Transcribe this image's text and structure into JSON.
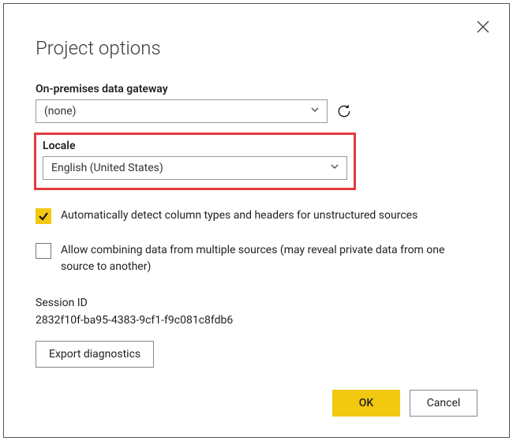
{
  "title": "Project options",
  "gateway": {
    "label": "On-premises data gateway",
    "value": "(none)"
  },
  "locale": {
    "label": "Locale",
    "value": "English (United States)"
  },
  "checkboxes": {
    "autodetect": {
      "label": "Automatically detect column types and headers for unstructured sources",
      "checked": true
    },
    "combine": {
      "label": "Allow combining data from multiple sources (may reveal private data from one source to another)",
      "checked": false
    }
  },
  "session": {
    "label": "Session ID",
    "value": "2832f10f-ba95-4383-9cf1-f9c081c8fdb6"
  },
  "buttons": {
    "export": "Export diagnostics",
    "ok": "OK",
    "cancel": "Cancel"
  }
}
